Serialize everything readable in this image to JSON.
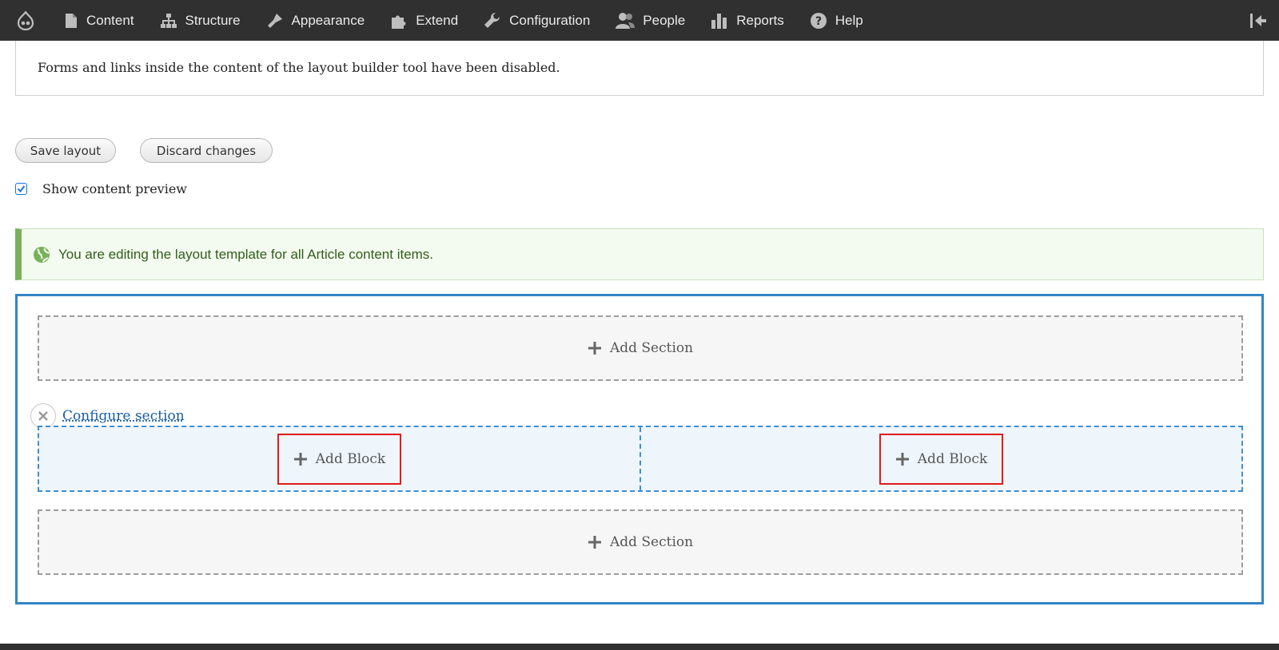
{
  "toolbar": {
    "items": [
      {
        "label": "Content",
        "icon": "file-icon"
      },
      {
        "label": "Structure",
        "icon": "sitemap-icon"
      },
      {
        "label": "Appearance",
        "icon": "paintbrush-icon"
      },
      {
        "label": "Extend",
        "icon": "puzzle-icon"
      },
      {
        "label": "Configuration",
        "icon": "wrench-icon"
      },
      {
        "label": "People",
        "icon": "people-icon"
      },
      {
        "label": "Reports",
        "icon": "bar-chart-icon"
      },
      {
        "label": "Help",
        "icon": "help-icon"
      }
    ]
  },
  "message": {
    "text": "Forms and links inside the content of the layout builder tool have been disabled."
  },
  "actions": {
    "save_label": "Save layout",
    "discard_label": "Discard changes"
  },
  "preview": {
    "label": "Show content preview",
    "checked": true
  },
  "status": {
    "text": "You are editing the layout template for all Article content items.",
    "color": "#77b259"
  },
  "layout_builder": {
    "add_section_label": "Add Section",
    "configure_section_label": "Configure section",
    "add_block_label": "Add Block",
    "accent_color": "#3385c6"
  }
}
